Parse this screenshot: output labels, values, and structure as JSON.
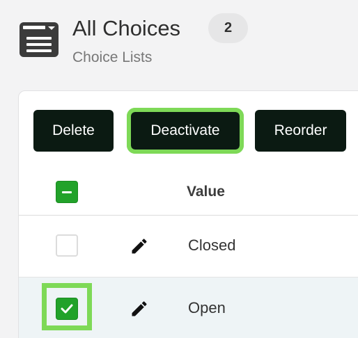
{
  "header": {
    "icon": "list-box-icon",
    "title": "All Choices",
    "count": "2",
    "subtitle": "Choice Lists"
  },
  "toolbar": {
    "delete_label": "Delete",
    "deactivate_label": "Deactivate",
    "reorder_label": "Reorder"
  },
  "table": {
    "columns": [
      "Value"
    ],
    "rows": [
      {
        "value": "Closed",
        "selected": false
      },
      {
        "value": "Open",
        "selected": true
      }
    ]
  },
  "colors": {
    "button_bg": "#0b1a12",
    "checkbox_green": "#22a22a",
    "highlight": "#7ed957",
    "selected_row_bg": "#eef4f6"
  }
}
